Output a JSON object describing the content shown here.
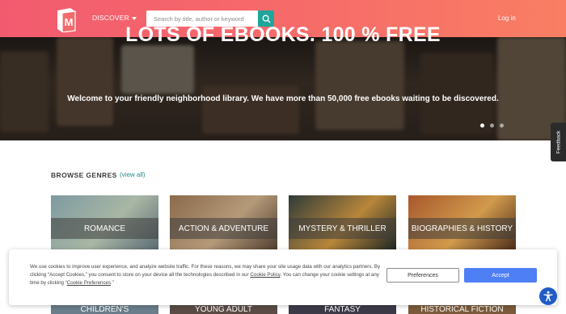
{
  "header": {
    "discover_label": "DISCOVER",
    "search_placeholder": "Search by title, author or keyword",
    "login_label": "Log in",
    "logo_letter": "M",
    "gradient": [
      "#f25b6f",
      "#f97e63"
    ]
  },
  "hero": {
    "title": "LOTS OF EBOOKS. 100 % FREE",
    "subtitle": "Welcome to your friendly neighborhood library. We have more than 50,000 free ebooks waiting to be discovered.",
    "slide_count": 3,
    "active_slide": 1
  },
  "feedback_label": "Feedback",
  "genres": {
    "heading": "BROWSE GENRES",
    "view_all": "(view all)",
    "items": [
      {
        "label": "ROMANCE",
        "colors": [
          "#7d9aa0",
          "#a9b7a5",
          "#5a6a72"
        ]
      },
      {
        "label": "ACTION & ADVENTURE",
        "colors": [
          "#8a6a4b",
          "#b59a7a",
          "#4f3d2e"
        ]
      },
      {
        "label": "MYSTERY & THRILLER",
        "colors": [
          "#2f3b3a",
          "#b8863a",
          "#1c2524"
        ]
      },
      {
        "label": "BIOGRAPHIES & HISTORY",
        "colors": [
          "#a8582c",
          "#d19a4c",
          "#4b2b1a"
        ]
      }
    ],
    "items_row2": [
      {
        "label": "CHILDREN'S",
        "color": "#6a7d8a"
      },
      {
        "label": "YOUNG ADULT",
        "color": "#5a4c45"
      },
      {
        "label": "FANTASY",
        "color": "#3d3a48"
      },
      {
        "label": "HISTORICAL FICTION",
        "color": "#7a5a3a"
      }
    ]
  },
  "cookie": {
    "text_1": "We use cookies to improve user experience, and analyze website traffic. For these reasons, we may share your site usage data with our analytics partners. By clicking “Accept Cookies,” you consent to store on your device all the technologies described in our ",
    "policy_link": "Cookie Policy",
    "text_2": ". You can change your cookie settings at any time by clicking “",
    "prefs_link": "Cookie Preferences",
    "text_3": ".”",
    "preferences_label": "Preferences",
    "accept_label": "Accept",
    "accent": "#4f7ff5"
  },
  "icons": {
    "search": "search-icon",
    "accessibility": "accessibility-icon",
    "logo": "book-logo-icon"
  }
}
